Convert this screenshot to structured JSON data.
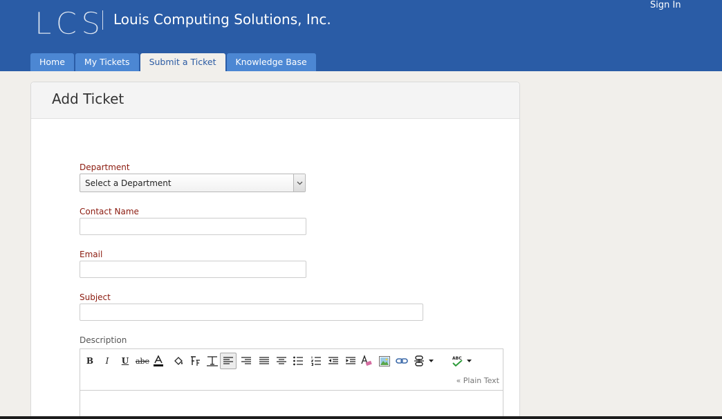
{
  "header": {
    "logo_text": "LCS",
    "company": "Louis Computing Solutions, Inc.",
    "signin_label": "Sign In"
  },
  "nav": {
    "tabs": [
      {
        "label": "Home"
      },
      {
        "label": "My Tickets"
      },
      {
        "label": "Submit a Ticket",
        "active": true
      },
      {
        "label": "Knowledge Base"
      }
    ]
  },
  "form": {
    "title": "Add Ticket",
    "department": {
      "label": "Department",
      "selected": "Select a Department"
    },
    "contact_name": {
      "label": "Contact Name",
      "value": ""
    },
    "email": {
      "label": "Email",
      "value": ""
    },
    "subject": {
      "label": "Subject",
      "value": ""
    },
    "description": {
      "label": "Description",
      "plain_text_link": "« Plain Text",
      "value": ""
    }
  },
  "editor_toolbar": [
    "bold-icon",
    "italic-icon",
    "underline-icon",
    "strikethrough-icon",
    "font-color-icon",
    "highlight-icon",
    "font-family-icon",
    "font-size-icon",
    "align-left-icon",
    "align-right-icon",
    "justify-icon",
    "align-center-icon",
    "bullet-list-icon",
    "numbered-list-icon",
    "outdent-icon",
    "indent-icon",
    "remove-format-icon",
    "image-icon",
    "link-icon",
    "unlink-icon",
    "spellcheck-icon"
  ],
  "colors": {
    "header_bg": "#2a5ca6",
    "tab_bg": "#4c87d3",
    "label_red": "#8b1a0e",
    "page_bg": "#f1efeb"
  }
}
